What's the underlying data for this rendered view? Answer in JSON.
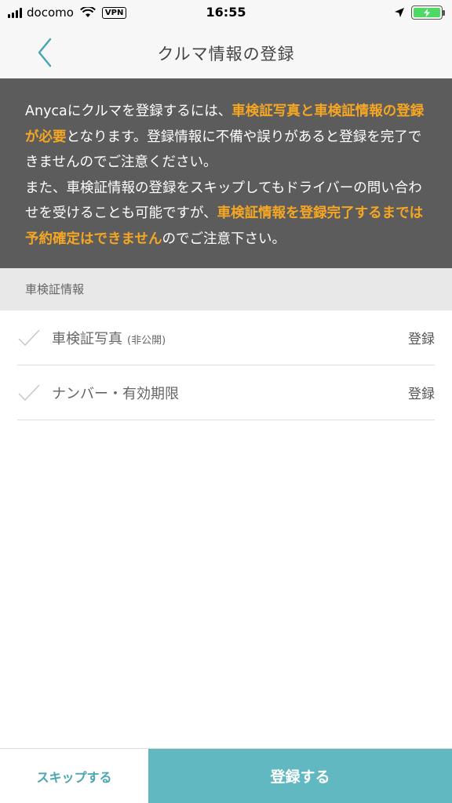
{
  "status_bar": {
    "carrier": "docomo",
    "vpn": "VPN",
    "time": "16:55",
    "icons": [
      "signal-icon",
      "wifi-icon",
      "location-arrow-icon",
      "battery-icon"
    ]
  },
  "nav": {
    "title": "クルマ情報の登録",
    "back_icon": "chevron-left-icon"
  },
  "notice": {
    "parts": [
      {
        "text": "Anycaにクルマを登録するには、",
        "highlight": false
      },
      {
        "text": "車検証写真と車検証情報の登録が必要",
        "highlight": true
      },
      {
        "text": "となります。登録情報に不備や誤りがあると登録を完了できませんのでご注意ください。",
        "highlight": false
      },
      {
        "text": "また、車検証情報の登録をスキップしてもドライバーの問い合わせを受けることも可能ですが、",
        "highlight": false
      },
      {
        "text": "車検証情報を登録完了するまでは予約確定はできません",
        "highlight": true
      },
      {
        "text": "のでご注意下さい。",
        "highlight": false
      }
    ]
  },
  "section": {
    "header": "車検証情報"
  },
  "items": [
    {
      "label": "車検証写真",
      "note": "(非公開)",
      "action": "登録"
    },
    {
      "label": "ナンバー・有効期限",
      "note": "",
      "action": "登録"
    }
  ],
  "buttons": {
    "skip": "スキップする",
    "register": "登録する"
  },
  "colors": {
    "accent": "#62b8c1",
    "accent_text": "#4aa6b0",
    "highlight": "#f5a623",
    "notice_bg": "#5c5c5c",
    "battery": "#4cd964"
  }
}
